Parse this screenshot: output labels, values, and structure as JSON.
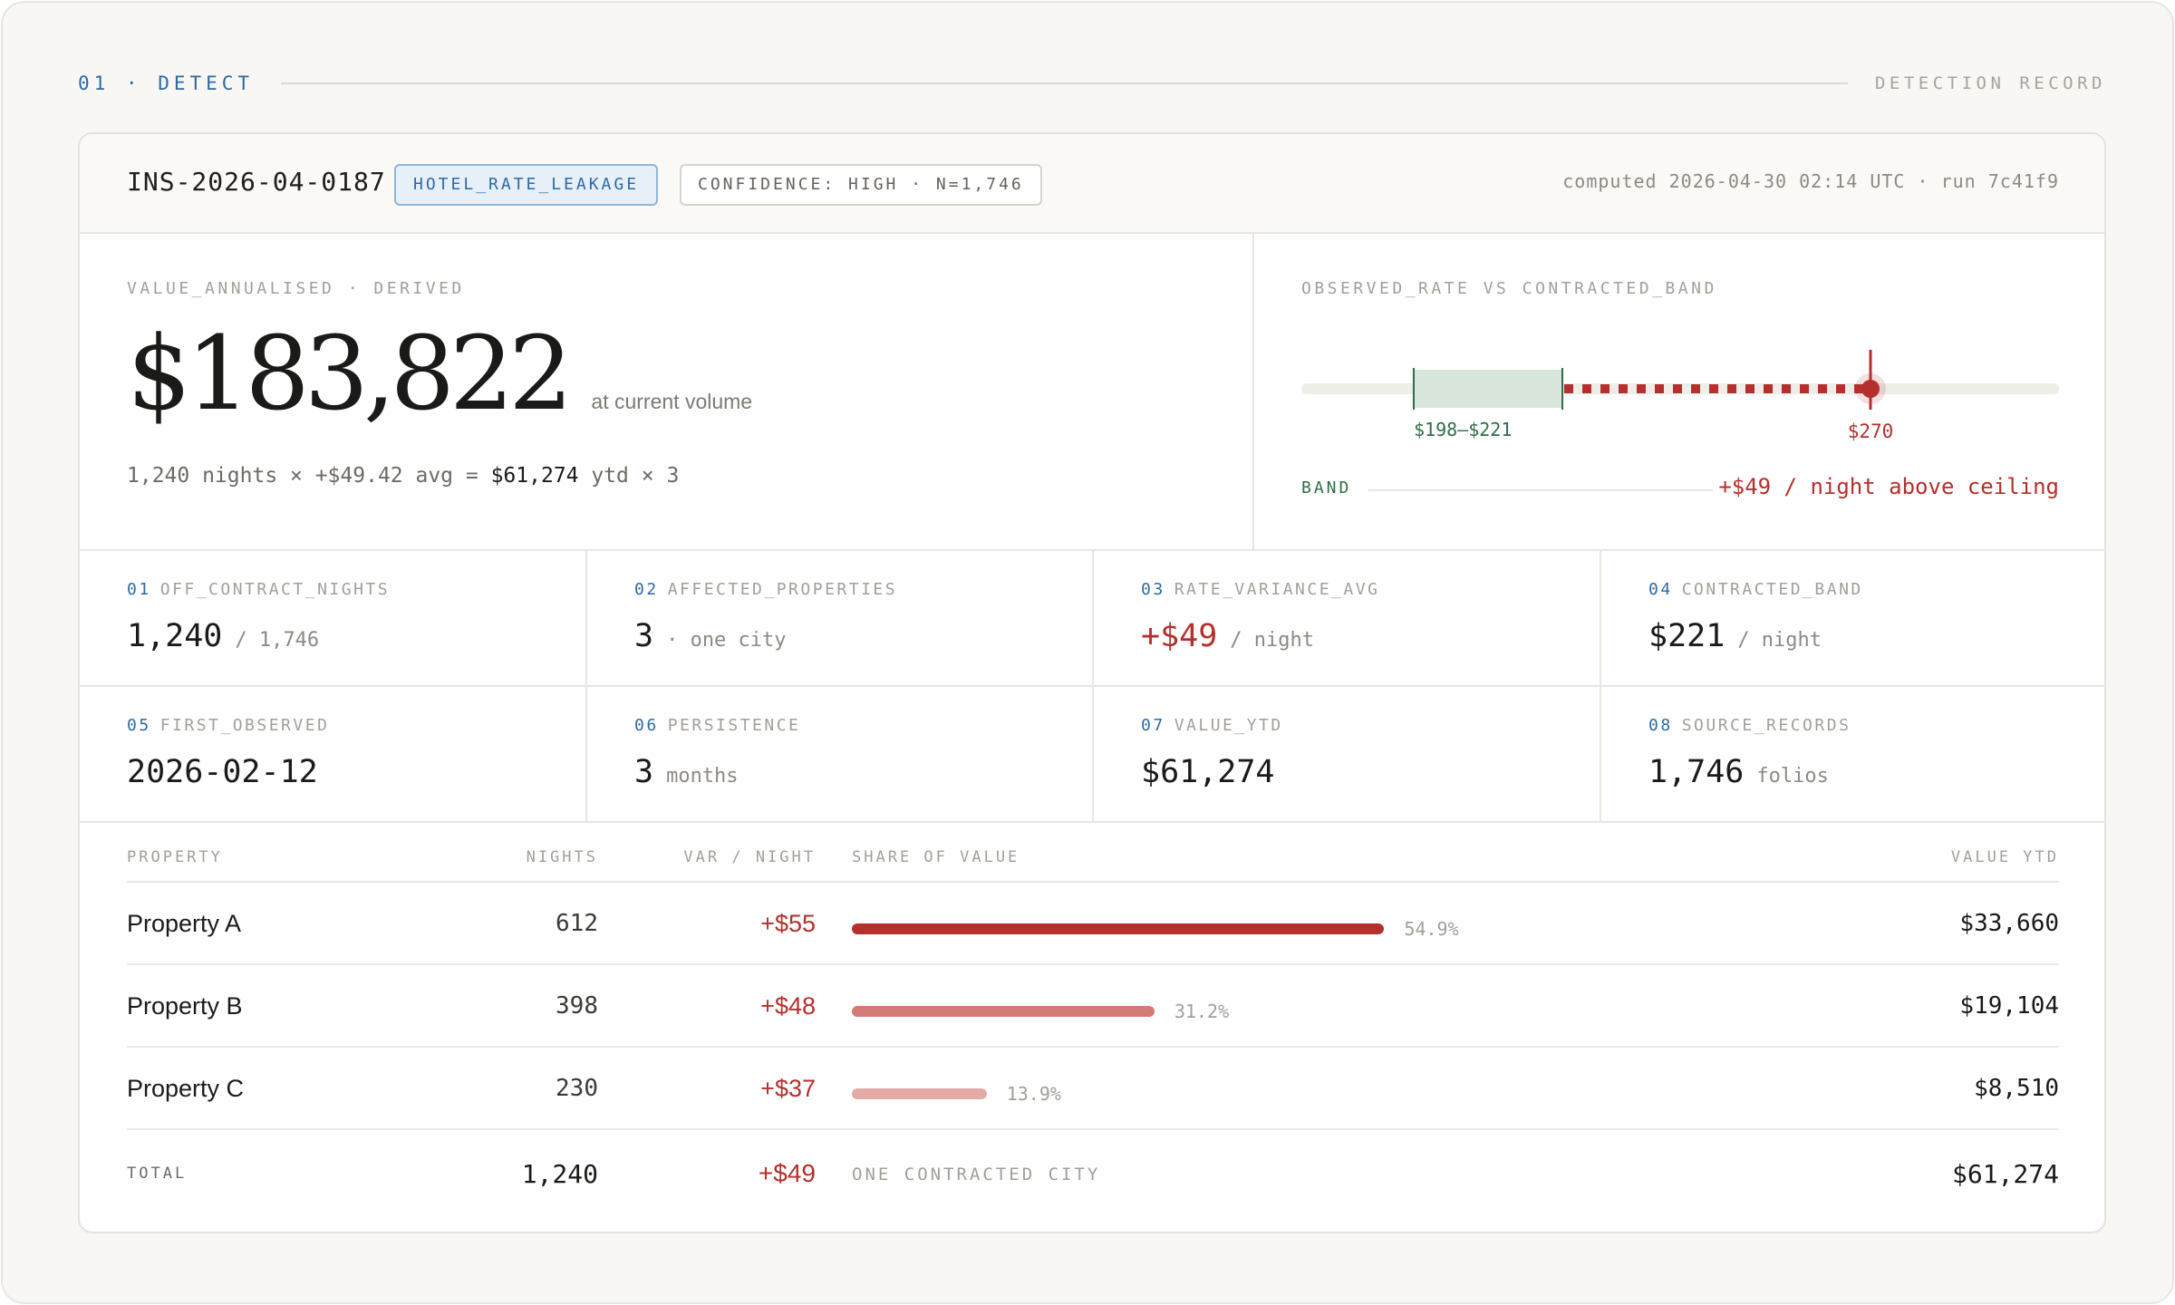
{
  "section": {
    "title": "01 · DETECT",
    "right_label": "DETECTION RECORD"
  },
  "header": {
    "insight_id": "INS-2026-04-0187",
    "category_badge": "HOTEL_RATE_LEAKAGE",
    "confidence_badge": "CONFIDENCE: HIGH · N=1,746",
    "computed": "computed 2026-04-30 02:14 UTC · run 7c41f9"
  },
  "value_panel": {
    "kicker": "VALUE_ANNUALISED · DERIVED",
    "value": "$183,822",
    "note": "at current volume",
    "formula_prefix": "1,240 nights × +$49.42 avg = ",
    "formula_ytd": "$61,274",
    "formula_suffix": " ytd × 3"
  },
  "rate_panel": {
    "kicker": "OBSERVED_RATE VS CONTRACTED_BAND",
    "band_text": "$198–$221",
    "observed_text": "$270",
    "band_label": "BAND",
    "ceiling_note": "+$49 / night above ceiling",
    "scale": {
      "band_low": 198,
      "band_high": 221,
      "observed": 270
    },
    "colors": {
      "band": "#2f6d46",
      "observed": "#b3302c"
    }
  },
  "metrics": [
    {
      "num": "01",
      "label": "OFF_CONTRACT_NIGHTS",
      "value": "1,240",
      "unit": "/ 1,746"
    },
    {
      "num": "02",
      "label": "AFFECTED_PROPERTIES",
      "value": "3",
      "unit": "· one city"
    },
    {
      "num": "03",
      "label": "RATE_VARIANCE_AVG",
      "value": "+$49",
      "unit": "/ night"
    },
    {
      "num": "04",
      "label": "CONTRACTED_BAND",
      "value": "$221",
      "unit": "/ night"
    },
    {
      "num": "05",
      "label": "FIRST_OBSERVED",
      "value": "2026-02-12",
      "unit": ""
    },
    {
      "num": "06",
      "label": "PERSISTENCE",
      "value": "3",
      "unit": "months"
    },
    {
      "num": "07",
      "label": "VALUE_YTD",
      "value": "$61,274",
      "unit": ""
    },
    {
      "num": "08",
      "label": "SOURCE_RECORDS",
      "value": "1,746",
      "unit": "folios"
    }
  ],
  "table": {
    "headers": {
      "property": "PROPERTY",
      "nights": "NIGHTS",
      "var": "VAR / NIGHT",
      "share": "SHARE OF VALUE",
      "value": "VALUE YTD"
    },
    "rows": [
      {
        "property": "Property A",
        "nights": "612",
        "var": "+$55",
        "share": 54.9,
        "share_text": "54.9%",
        "value": "$33,660",
        "color": "#b3302c"
      },
      {
        "property": "Property B",
        "nights": "398",
        "var": "+$48",
        "share": 31.2,
        "share_text": "31.2%",
        "value": "$19,104",
        "color": "#d47a76"
      },
      {
        "property": "Property C",
        "nights": "230",
        "var": "+$37",
        "share": 13.9,
        "share_text": "13.9%",
        "value": "$8,510",
        "color": "#e3aaa6"
      }
    ],
    "total": {
      "label": "TOTAL",
      "nights": "1,240",
      "var": "+$49",
      "note": "ONE CONTRACTED CITY",
      "value": "$61,274"
    }
  }
}
